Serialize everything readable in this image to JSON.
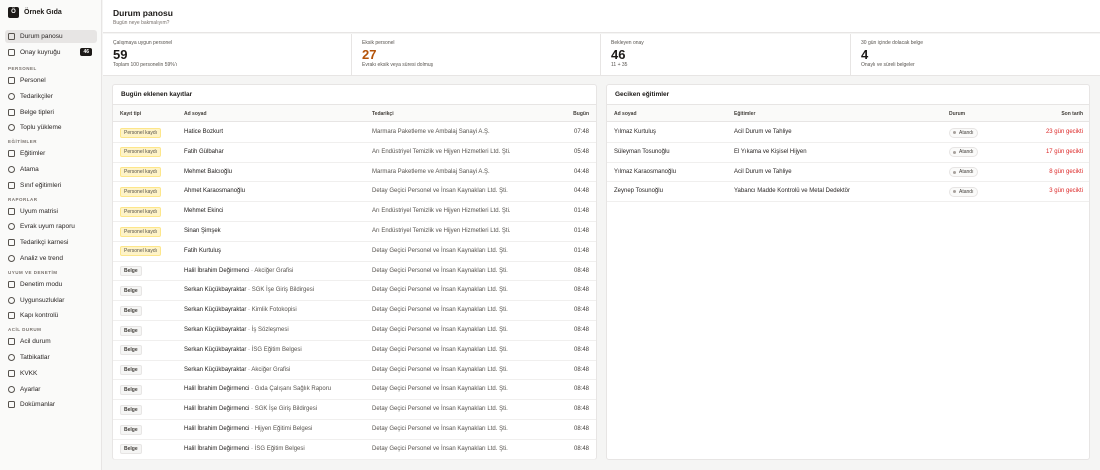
{
  "app": {
    "logo_letter": "Ö",
    "name": "Örnek Gıda"
  },
  "sidebar": {
    "top_items": [
      {
        "label": "Durum panosu",
        "active": true
      },
      {
        "label": "Onay kuyruğu",
        "badge": "46"
      }
    ],
    "sections": [
      {
        "title": "PERSONEL",
        "items": [
          "Personel",
          "Tedarikçiler",
          "Belge tipleri",
          "Toplu yükleme"
        ]
      },
      {
        "title": "EĞİTİMLER",
        "items": [
          "Eğitimler",
          "Atama",
          "Sınıf eğitimleri"
        ]
      },
      {
        "title": "RAPORLAR",
        "items": [
          "Uyum matrisi",
          "Evrak uyum raporu",
          "Tedarikçi karnesi",
          "Analiz ve trend"
        ]
      },
      {
        "title": "UYUM VE DENETİM",
        "items": [
          "Denetim modu",
          "Uygunsuzluklar",
          "Kapı kontrolü"
        ]
      },
      {
        "title": "ACİL DURUM",
        "items": [
          "Acil durum",
          "Tatbikatlar",
          "KVKK",
          "Ayarlar",
          "Dokümanlar"
        ]
      }
    ]
  },
  "header": {
    "title": "Durum panosu",
    "subtitle": "Bugün neye bakmalıyım?"
  },
  "stats": [
    {
      "label": "Çalışmaya uygun personel",
      "value": "59",
      "note": "Toplam 100 personelin 59%'ı",
      "color": "#1c1917"
    },
    {
      "label": "Eksik personel",
      "value": "27",
      "note": "Evrakı eksik veya süresi dolmuş",
      "color": "#b45309"
    },
    {
      "label": "Bekleyen onay",
      "value": "46",
      "note": "11 + 35",
      "color": "#1c1917"
    },
    {
      "label": "30 gün içinde dolacak belge",
      "value": "4",
      "note": "Onaylı ve süreli belgeler",
      "color": "#1c1917"
    }
  ],
  "today": {
    "title": "Bugün eklenen kayıtlar",
    "columns": [
      "Kayıt tipi",
      "Ad soyad",
      "Tedarikçi",
      "Bugün"
    ],
    "rows": [
      {
        "type": "Personel kaydı",
        "kind": "personel",
        "name": "Hatice Bozkurt",
        "doc": "",
        "supplier": "Marmara Paketleme ve Ambalaj Sanayi A.Ş.",
        "time": "07:48"
      },
      {
        "type": "Personel kaydı",
        "kind": "personel",
        "name": "Fatih Gülbahar",
        "doc": "",
        "supplier": "Arı Endüstriyel Temizlik ve Hijyen Hizmetleri Ltd. Şti.",
        "time": "05:48"
      },
      {
        "type": "Personel kaydı",
        "kind": "personel",
        "name": "Mehmet Balcıoğlu",
        "doc": "",
        "supplier": "Marmara Paketleme ve Ambalaj Sanayi A.Ş.",
        "time": "04:48"
      },
      {
        "type": "Personel kaydı",
        "kind": "personel",
        "name": "Ahmet Karaosmanoğlu",
        "doc": "",
        "supplier": "Detay Geçici Personel ve İnsan Kaynakları Ltd. Şti.",
        "time": "04:48"
      },
      {
        "type": "Personel kaydı",
        "kind": "personel",
        "name": "Mehmet Ekinci",
        "doc": "",
        "supplier": "Arı Endüstriyel Temizlik ve Hijyen Hizmetleri Ltd. Şti.",
        "time": "01:48"
      },
      {
        "type": "Personel kaydı",
        "kind": "personel",
        "name": "Sinan Şimşek",
        "doc": "",
        "supplier": "Arı Endüstriyel Temizlik ve Hijyen Hizmetleri Ltd. Şti.",
        "time": "01:48"
      },
      {
        "type": "Personel kaydı",
        "kind": "personel",
        "name": "Fatih Kurtuluş",
        "doc": "",
        "supplier": "Detay Geçici Personel ve İnsan Kaynakları Ltd. Şti.",
        "time": "01:48"
      },
      {
        "type": "Belge",
        "kind": "belge",
        "name": "Halil İbrahim Değirmenci",
        "doc": " · Akciğer Grafisi",
        "supplier": "Detay Geçici Personel ve İnsan Kaynakları Ltd. Şti.",
        "time": "08:48"
      },
      {
        "type": "Belge",
        "kind": "belge",
        "name": "Serkan Küçükbayraktar",
        "doc": " · SGK İşe Giriş Bildirgesi",
        "supplier": "Detay Geçici Personel ve İnsan Kaynakları Ltd. Şti.",
        "time": "08:48"
      },
      {
        "type": "Belge",
        "kind": "belge",
        "name": "Serkan Küçükbayraktar",
        "doc": " · Kimlik Fotokopisi",
        "supplier": "Detay Geçici Personel ve İnsan Kaynakları Ltd. Şti.",
        "time": "08:48"
      },
      {
        "type": "Belge",
        "kind": "belge",
        "name": "Serkan Küçükbayraktar",
        "doc": " · İş Sözleşmesi",
        "supplier": "Detay Geçici Personel ve İnsan Kaynakları Ltd. Şti.",
        "time": "08:48"
      },
      {
        "type": "Belge",
        "kind": "belge",
        "name": "Serkan Küçükbayraktar",
        "doc": " · İSG Eğitim Belgesi",
        "supplier": "Detay Geçici Personel ve İnsan Kaynakları Ltd. Şti.",
        "time": "08:48"
      },
      {
        "type": "Belge",
        "kind": "belge",
        "name": "Serkan Küçükbayraktar",
        "doc": " · Akciğer Grafisi",
        "supplier": "Detay Geçici Personel ve İnsan Kaynakları Ltd. Şti.",
        "time": "08:48"
      },
      {
        "type": "Belge",
        "kind": "belge",
        "name": "Halil İbrahim Değirmenci",
        "doc": " · Gıda Çalışanı Sağlık Raporu",
        "supplier": "Detay Geçici Personel ve İnsan Kaynakları Ltd. Şti.",
        "time": "08:48"
      },
      {
        "type": "Belge",
        "kind": "belge",
        "name": "Halil İbrahim Değirmenci",
        "doc": " · SGK İşe Giriş Bildirgesi",
        "supplier": "Detay Geçici Personel ve İnsan Kaynakları Ltd. Şti.",
        "time": "08:48"
      },
      {
        "type": "Belge",
        "kind": "belge",
        "name": "Halil İbrahim Değirmenci",
        "doc": " · Hijyen Eğitimi Belgesi",
        "supplier": "Detay Geçici Personel ve İnsan Kaynakları Ltd. Şti.",
        "time": "08:48"
      },
      {
        "type": "Belge",
        "kind": "belge",
        "name": "Halil İbrahim Değirmenci",
        "doc": " · İSG Eğitim Belgesi",
        "supplier": "Detay Geçici Personel ve İnsan Kaynakları Ltd. Şti.",
        "time": "08:48"
      }
    ]
  },
  "late": {
    "title": "Geciken eğitimler",
    "columns": [
      "Ad soyad",
      "Eğitimler",
      "Durum",
      "Son tarih"
    ],
    "rows": [
      {
        "name": "Yılmaz Kurtuluş",
        "training": "Acil Durum ve Tahliye",
        "status": "Atandı",
        "due": "23 gün gecikti"
      },
      {
        "name": "Süleyman Tosunoğlu",
        "training": "El Yıkama ve Kişisel Hijyen",
        "status": "Atandı",
        "due": "17 gün gecikti"
      },
      {
        "name": "Yılmaz Karaosmanoğlu",
        "training": "Acil Durum ve Tahliye",
        "status": "Atandı",
        "due": "8 gün gecikti"
      },
      {
        "name": "Zeynep Tosunoğlu",
        "training": "Yabancı Madde Kontrolü ve Metal Dedektör",
        "status": "Atandı",
        "due": "3 gün gecikti"
      }
    ]
  }
}
